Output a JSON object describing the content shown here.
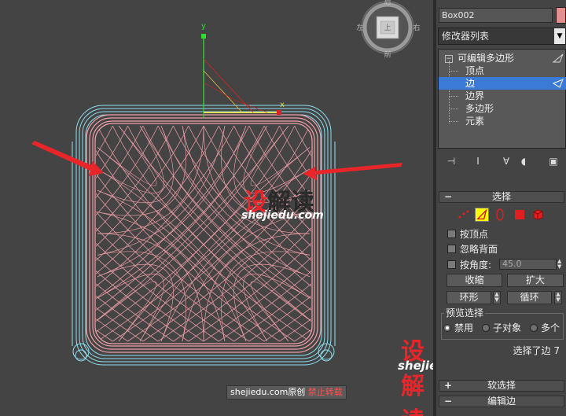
{
  "viewport": {
    "gizmo_y_label": "y",
    "gizmo_x_label": "x",
    "viewcube_face": "上",
    "viewcube_compass": [
      "前",
      "右",
      "后",
      "左"
    ]
  },
  "watermark": {
    "logo_prefix": "设",
    "logo_suffix": "解读",
    "url": "shejiedu.com",
    "credit_site": "shejiedu.com",
    "credit_original": "原创",
    "credit_forbid": "禁止转载"
  },
  "panel": {
    "object_name": "Box002",
    "object_color": "#e29090",
    "modifier_list": "修改器列表",
    "stack": {
      "root": "可编辑多边形",
      "items": [
        "顶点",
        "边",
        "边界",
        "多边形",
        "元素"
      ],
      "selected_index": 1
    },
    "selection_rollout": {
      "title": "选择",
      "by_vertex": "按顶点",
      "ignore_backfacing": "忽略背面",
      "by_angle": "按角度:",
      "angle_value": "45.0",
      "shrink": "收缩",
      "grow": "扩大",
      "ring": "环形",
      "loop": "循环",
      "preview_group": "预览选择",
      "preview_options": [
        "禁用",
        "子对象",
        "多个"
      ],
      "preview_selected": 0,
      "status": "选择了边 7"
    },
    "soft_selection": {
      "title": "软选择"
    },
    "edit_edges": {
      "title": "编辑边"
    }
  },
  "colors": {
    "viewport_bg": "#444444",
    "mesh_pink": "#f0a0a8",
    "mesh_cyan": "#8ee0f0",
    "selection_blue": "#3b7ad6",
    "arrow_red": "#e8262a",
    "watermark_red": "#e8262a"
  }
}
